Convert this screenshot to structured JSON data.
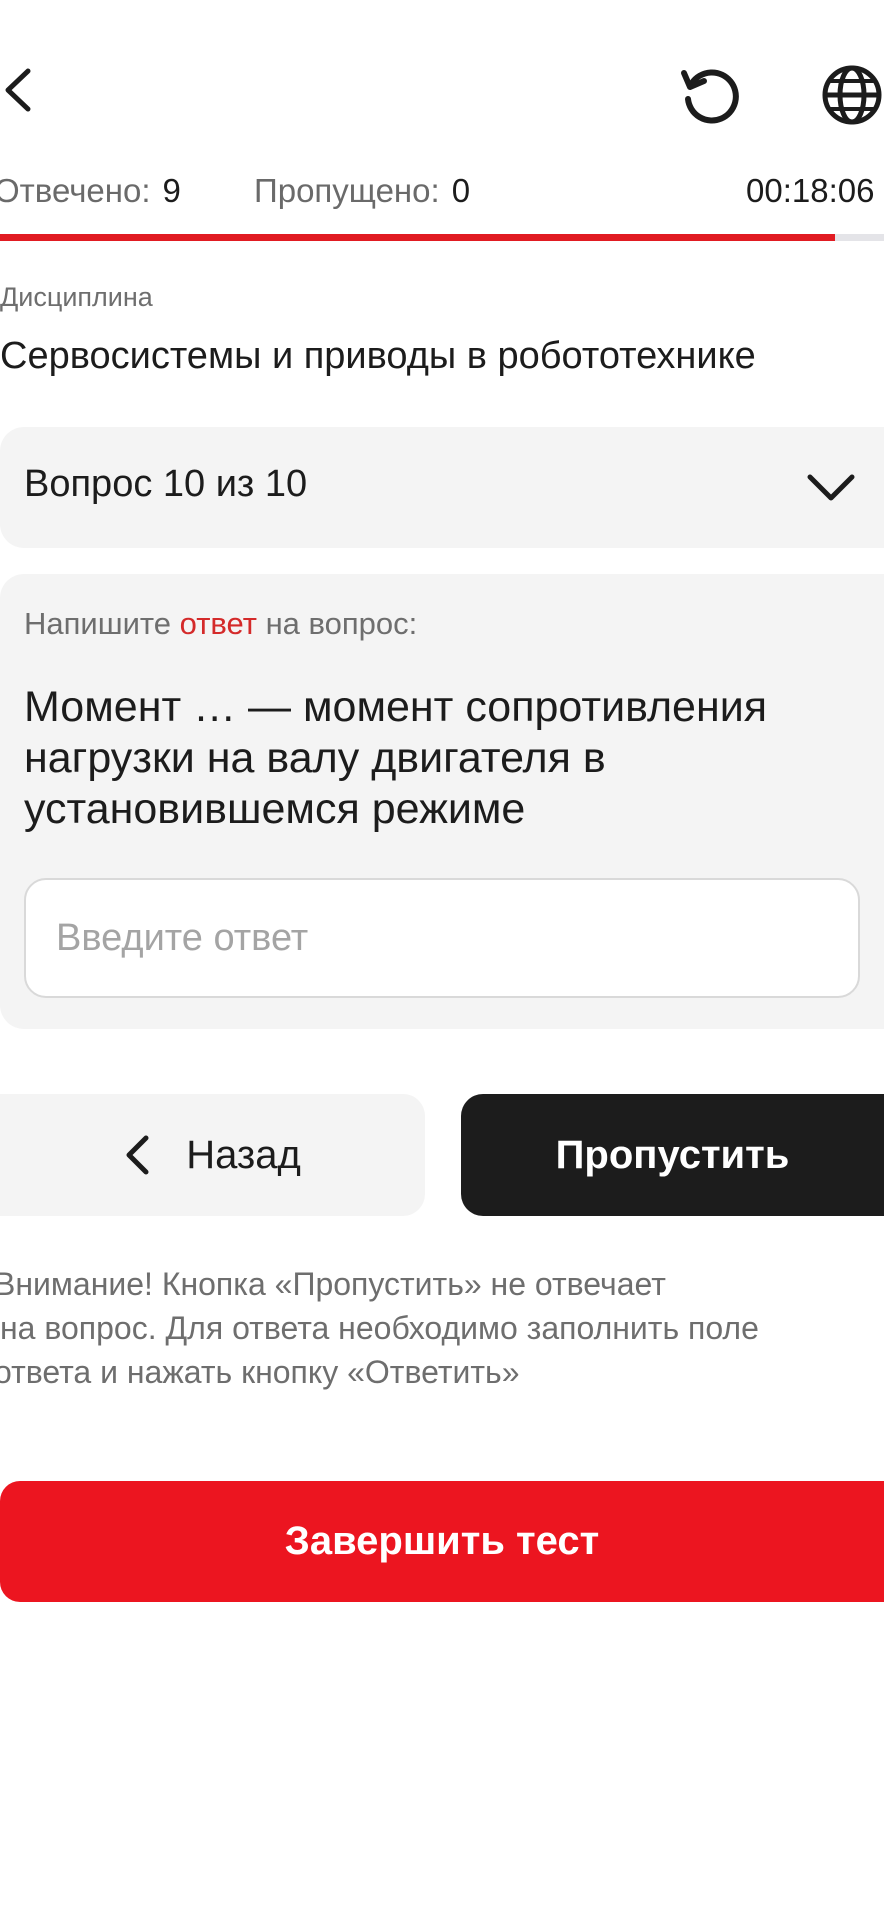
{
  "header": {
    "back_icon": "chevron-left-icon",
    "reset_icon": "reset-icon",
    "language_icon": "globe-icon"
  },
  "stats": {
    "answered_label": "Отвечено:",
    "answered_value": "9",
    "skipped_label": "Пропущено:",
    "skipped_value": "0",
    "timer": "00:18:06"
  },
  "progress": {
    "fraction": 0.945,
    "fill_color": "#e11b22",
    "track_color": "#e4e4e8"
  },
  "discipline": {
    "label": "Дисциплина",
    "title": "Сервосистемы и приводы в робототехнике"
  },
  "question_selector": {
    "label": "Вопрос 10 из 10",
    "icon": "chevron-down-icon"
  },
  "question_card": {
    "prompt_before": "Напишите",
    "prompt_accent": "ответ",
    "prompt_after": "на вопрос:",
    "question_text": "Момент … — момент сопротивления нагрузки на валу двигателя в установившемся режиме",
    "answer_value": "",
    "answer_placeholder": "Введите ответ"
  },
  "buttons": {
    "back_label": "Назад",
    "skip_label": "Пропустить",
    "finish_label": "Завершить тест"
  },
  "warning": {
    "line1": "Внимание! Кнопка «Пропустить» не отвечает",
    "line2": "на вопрос. Для ответа необходимо заполнить поле",
    "line3": "ответа и нажать кнопку «Ответить»"
  },
  "colors": {
    "accent_red": "#ec1520",
    "dark": "#1c1c1c",
    "card_bg": "#f4f4f4"
  }
}
